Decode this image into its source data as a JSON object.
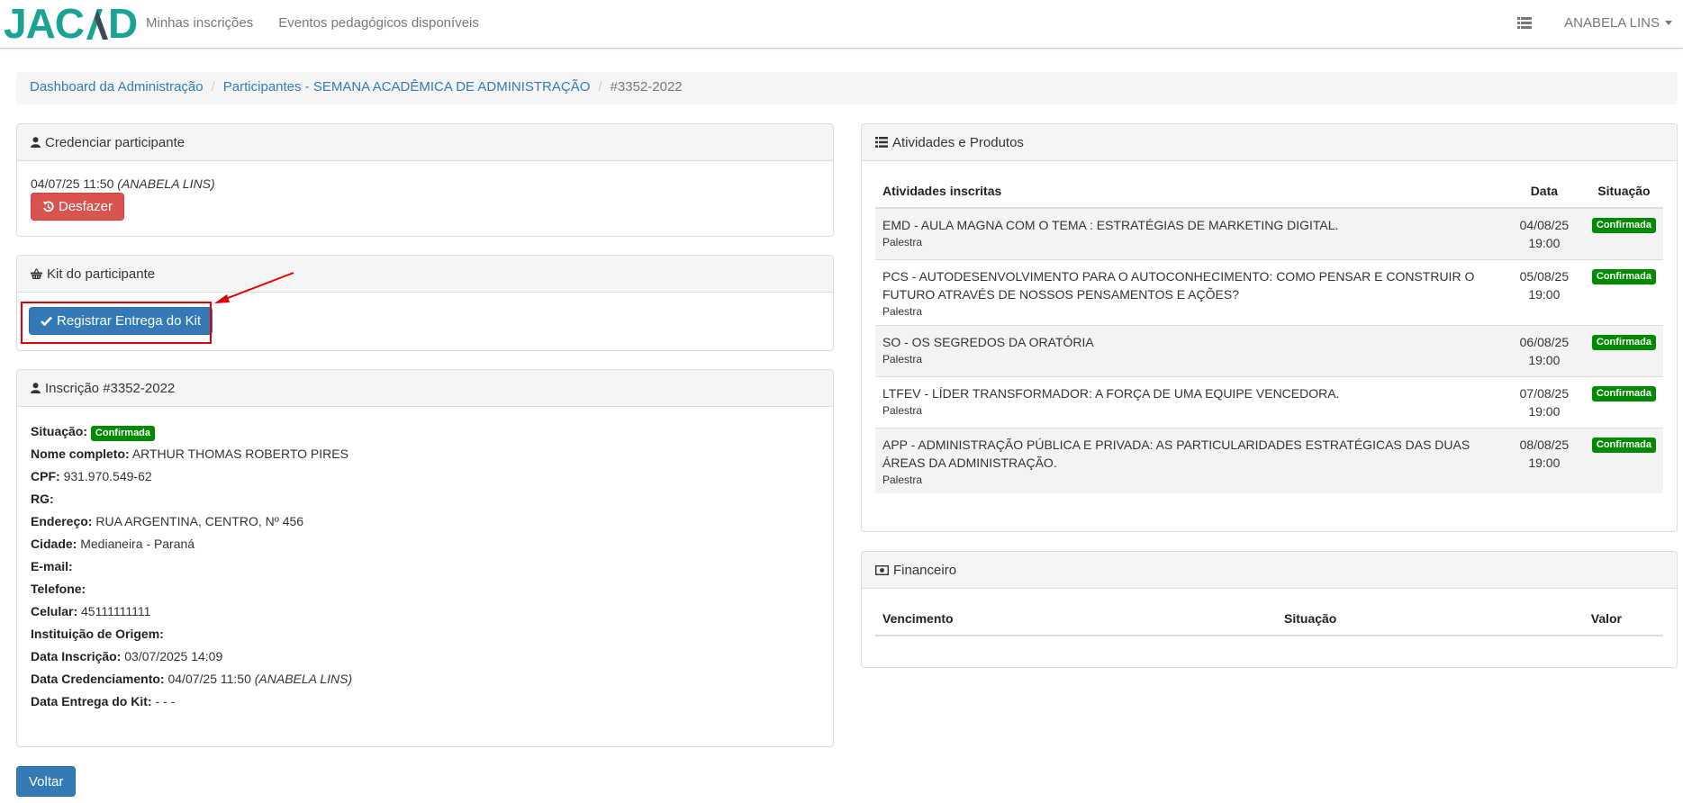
{
  "nav": {
    "brand": "JACAD",
    "links": [
      "Minhas inscrições",
      "Eventos pedagógicos disponíveis"
    ],
    "user": "ANABELA LINS"
  },
  "breadcrumb": {
    "items": [
      "Dashboard da Administração",
      "Participantes - SEMANA ACADÊMICA DE ADMINISTRAÇÃO"
    ],
    "current": "#3352-2022"
  },
  "credenciar": {
    "title": "Credenciar participante",
    "timestamp": "04/07/25 11:50",
    "by": "(ANABELA LINS)",
    "undo_label": "Desfazer"
  },
  "kit": {
    "title": "Kit do participante",
    "register_label": "Registrar Entrega do Kit"
  },
  "inscricao": {
    "title": "Inscrição #3352-2022",
    "status_label": "Situação:",
    "status_value": "Confirmada",
    "fields": [
      {
        "label": "Nome completo:",
        "value": "ARTHUR THOMAS ROBERTO PIRES"
      },
      {
        "label": "CPF:",
        "value": "931.970.549-62"
      },
      {
        "label": "RG:",
        "value": ""
      },
      {
        "label": "Endereço:",
        "value": "RUA ARGENTINA, CENTRO, Nº 456"
      },
      {
        "label": "Cidade:",
        "value": "Medianeira - Paraná"
      },
      {
        "label": "E-mail:",
        "value": ""
      },
      {
        "label": "Telefone:",
        "value": ""
      },
      {
        "label": "Celular:",
        "value": "45111111111"
      },
      {
        "label": "Instituição de Origem:",
        "value": ""
      },
      {
        "label": "Data Inscrição:",
        "value": "03/07/2025 14:09"
      }
    ],
    "credenciamento_label": "Data Credenciamento:",
    "credenciamento_value": "04/07/25 11:50",
    "credenciamento_by": "(ANABELA LINS)",
    "entrega_label": "Data Entrega do Kit:",
    "entrega_value": "- - -"
  },
  "atividades": {
    "title": "Atividades e Produtos",
    "headers": [
      "Atividades inscritas",
      "Data",
      "Situação"
    ],
    "rows": [
      {
        "name": "EMD - AULA MAGNA COM O TEMA : ESTRATÉGIAS DE MARKETING DIGITAL.",
        "type": "Palestra",
        "date": "04/08/25",
        "time": "19:00",
        "status": "Confirmada"
      },
      {
        "name": "PCS - AUTODESENVOLVIMENTO PARA O AUTOCONHECIMENTO: COMO PENSAR E CONSTRUIR O FUTURO ATRAVÉS DE NOSSOS PENSAMENTOS E AÇÕES?",
        "type": "Palestra",
        "date": "05/08/25",
        "time": "19:00",
        "status": "Confirmada"
      },
      {
        "name": "SO - OS SEGREDOS DA ORATÓRIA",
        "type": "Palestra",
        "date": "06/08/25",
        "time": "19:00",
        "status": "Confirmada"
      },
      {
        "name": "LTFEV - LÍDER TRANSFORMADOR: A FORÇA DE UMA EQUIPE VENCEDORA.",
        "type": "Palestra",
        "date": "07/08/25",
        "time": "19:00",
        "status": "Confirmada"
      },
      {
        "name": "APP - ADMINISTRAÇÃO PÚBLICA E PRIVADA: AS PARTICULARIDADES ESTRATÉGICAS DAS DUAS ÁREAS DA ADMINISTRAÇÃO.",
        "type": "Palestra",
        "date": "08/08/25",
        "time": "19:00",
        "status": "Confirmada"
      }
    ]
  },
  "financeiro": {
    "title": "Financeiro",
    "headers": [
      "Vencimento",
      "Situação",
      "Valor"
    ]
  },
  "footer": {
    "back_label": "Voltar"
  }
}
